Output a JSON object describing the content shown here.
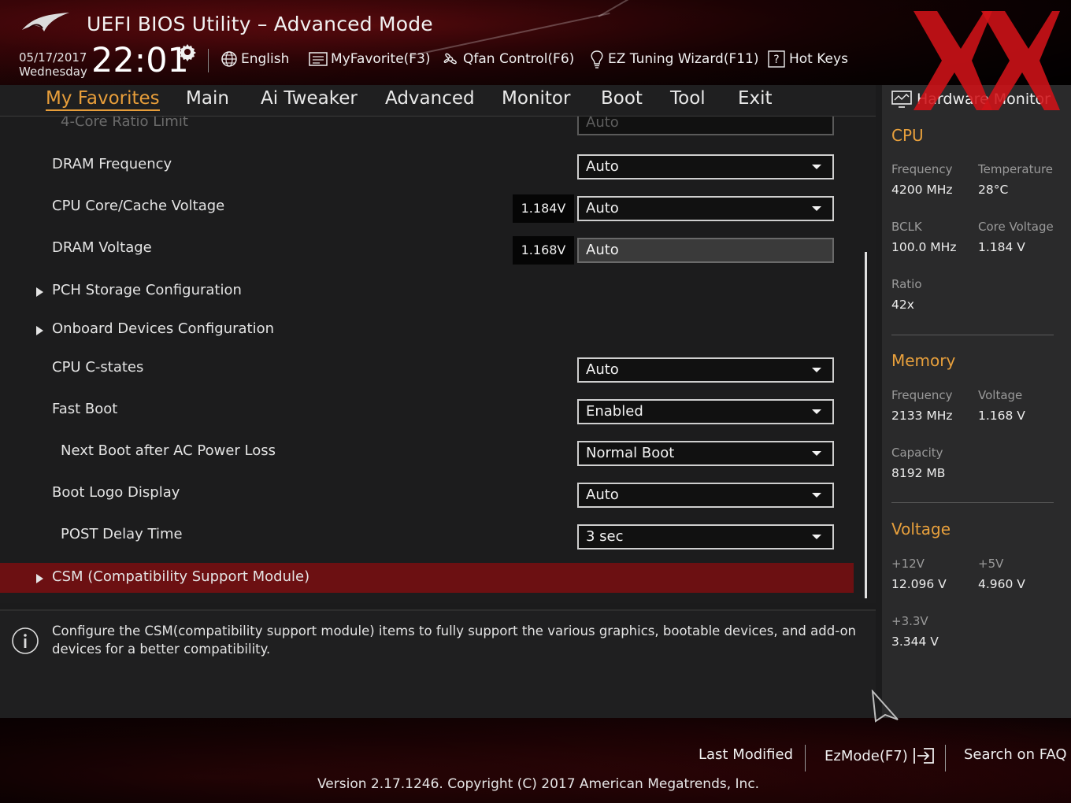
{
  "header": {
    "title": "UEFI BIOS Utility – Advanced Mode",
    "date": "05/17/2017",
    "weekday": "Wednesday",
    "time": "22:01",
    "toolbar": [
      {
        "label": "English",
        "icon": "globe-icon"
      },
      {
        "label": "MyFavorite(F3)",
        "icon": "favorite-list-icon"
      },
      {
        "label": "Qfan Control(F6)",
        "icon": "fan-icon"
      },
      {
        "label": "EZ Tuning Wizard(F11)",
        "icon": "lightbulb-icon"
      },
      {
        "label": "Hot Keys",
        "icon": "question-icon"
      }
    ]
  },
  "menu": {
    "tabs": [
      "My Favorites",
      "Main",
      "Ai Tweaker",
      "Advanced",
      "Monitor",
      "Boot",
      "Tool",
      "Exit"
    ],
    "active": "My Favorites"
  },
  "settings": [
    {
      "label": "4-Core Ratio Limit",
      "value": "Auto"
    },
    {
      "label": "DRAM Frequency",
      "value": "Auto"
    },
    {
      "label": "CPU Core/Cache Voltage",
      "readout": "1.184V",
      "value": "Auto"
    },
    {
      "label": "DRAM Voltage",
      "readout": "1.168V",
      "value": "Auto"
    },
    {
      "label": "PCH Storage Configuration"
    },
    {
      "label": "Onboard Devices Configuration"
    },
    {
      "label": "CPU C-states",
      "value": "Auto"
    },
    {
      "label": "Fast Boot",
      "value": "Enabled"
    },
    {
      "label": "Next Boot after AC Power Loss",
      "value": "Normal Boot"
    },
    {
      "label": "Boot Logo Display",
      "value": "Auto"
    },
    {
      "label": "POST Delay Time",
      "value": "3 sec"
    },
    {
      "label": "CSM (Compatibility Support Module)"
    }
  ],
  "help": {
    "text": "Configure the CSM(compatibility support module) items to fully support the various graphics, bootable devices, and add-on devices for a better compatibility."
  },
  "hw_monitor": {
    "title": "Hardware Monitor",
    "cpu": {
      "heading": "CPU",
      "frequency_label": "Frequency",
      "frequency": "4200 MHz",
      "temperature_label": "Temperature",
      "temperature": "28°C",
      "bclk_label": "BCLK",
      "bclk": "100.0 MHz",
      "core_voltage_label": "Core Voltage",
      "core_voltage": "1.184 V",
      "ratio_label": "Ratio",
      "ratio": "42x"
    },
    "memory": {
      "heading": "Memory",
      "frequency_label": "Frequency",
      "frequency": "2133 MHz",
      "voltage_label": "Voltage",
      "voltage": "1.168 V",
      "capacity_label": "Capacity",
      "capacity": "8192 MB"
    },
    "voltage": {
      "heading": "Voltage",
      "v12_label": "+12V",
      "v12": "12.096 V",
      "v5_label": "+5V",
      "v5": "4.960 V",
      "v33_label": "+3.3V",
      "v33": "3.344 V"
    }
  },
  "footer": {
    "last_modified": "Last Modified",
    "ezmode": "EzMode(F7)",
    "search_faq": "Search on FAQ",
    "version": "Version 2.17.1246. Copyright (C) 2017 American Megatrends, Inc."
  },
  "colors": {
    "accent": "#e89e3a",
    "selected_row": "#6c1012",
    "header_red": "#7a0d12",
    "watermark_red": "#d01218"
  }
}
